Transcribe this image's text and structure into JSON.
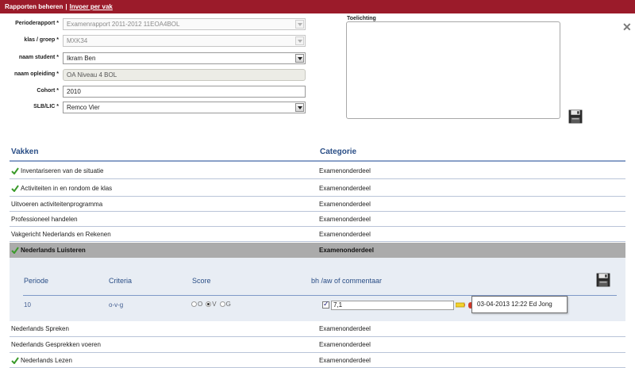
{
  "breadcrumb": {
    "item1": "Rapporten beheren",
    "separator": "|",
    "item2": "Invoer per vak"
  },
  "form": {
    "perioderapport": {
      "label": "Perioderapport *",
      "value": "Examenrapport 2011-2012 11EOA4BOL"
    },
    "klas": {
      "label": "klas / groep *",
      "value": "MXK34"
    },
    "student": {
      "label": "naam student *",
      "value": "Ikram Ben"
    },
    "opleiding": {
      "label": "naam opleiding *",
      "value": "OA Niveau 4 BOL"
    },
    "cohort": {
      "label": "Cohort *",
      "value": "2010"
    },
    "slb": {
      "label": "SLB/LIC *",
      "value": "Remco Vier"
    }
  },
  "toelichting": {
    "label": "Toelichting",
    "value": ""
  },
  "icons": {
    "close": "close-icon",
    "save": "floppy-disk-icon",
    "check": "green-checkmark-icon",
    "note": "note-pencil-icon"
  },
  "table": {
    "col_vakken": "Vakken",
    "col_categorie": "Categorie",
    "rows": [
      {
        "vak": "Inventariseren van de situatie",
        "categorie": "Examenonderdeel",
        "checked": true
      },
      {
        "vak": "Activiteiten in en rondom de klas",
        "categorie": "Examenonderdeel",
        "checked": true
      },
      {
        "vak": "Uitvoeren activiteitenprogramma",
        "categorie": "Examenonderdeel",
        "checked": false
      },
      {
        "vak": "Professioneel handelen",
        "categorie": "Examenonderdeel",
        "checked": false
      },
      {
        "vak": "Vakgericht Nederlands en Rekenen",
        "categorie": "Examenonderdeel",
        "checked": false
      },
      {
        "vak": "Nederlands Luisteren",
        "categorie": "Examenonderdeel",
        "checked": true,
        "active": true
      },
      {
        "vak": "Nederlands Spreken",
        "categorie": "Examenonderdeel",
        "checked": false
      },
      {
        "vak": "Nederlands Gesprekken voeren",
        "categorie": "Examenonderdeel",
        "checked": false
      },
      {
        "vak": "Nederlands Lezen",
        "categorie": "Examenonderdeel",
        "checked": true
      }
    ]
  },
  "detail": {
    "col_periode": "Periode",
    "col_criteria": "Criteria",
    "col_score": "Score",
    "col_commentaar": "bh /aw of commentaar",
    "periode": "10",
    "criteria": "o-v-g",
    "score_options": [
      "O",
      "V",
      "G"
    ],
    "score_selected": "V",
    "commentaar_checked": true,
    "commentaar": "7,1",
    "tooltip": "03-04-2013 12:22 Ed Jong"
  },
  "colors": {
    "topbar": "#9b1b2a",
    "header_text": "#2a4e86",
    "active_row": "#ababab",
    "detail_bg": "#e8edf4"
  }
}
